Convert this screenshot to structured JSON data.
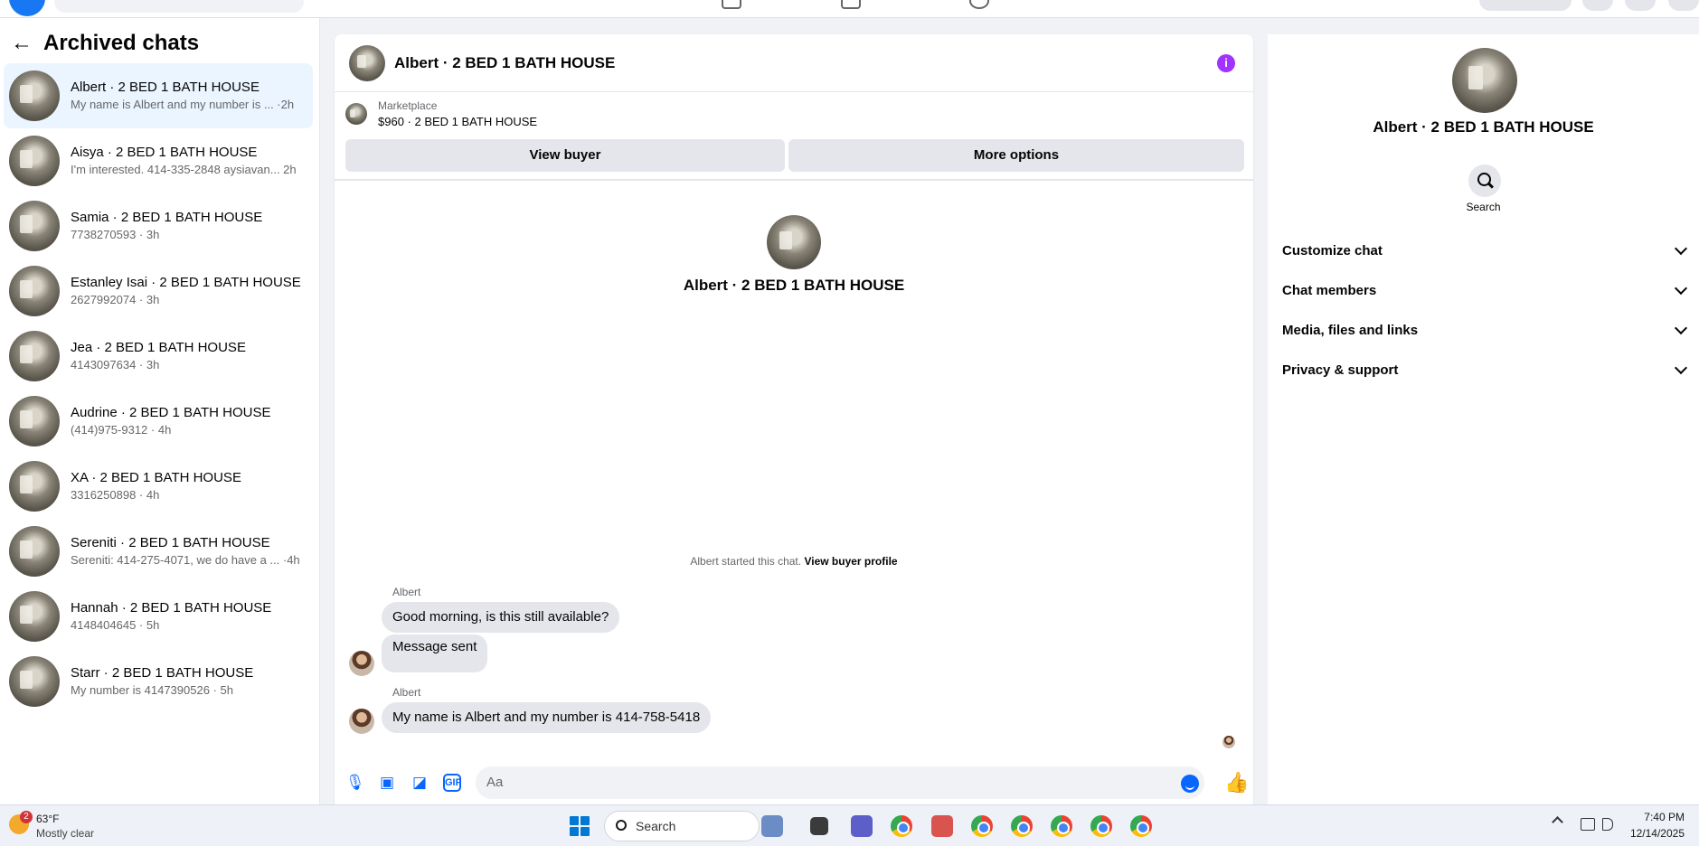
{
  "sidebar": {
    "title": "Archived chats",
    "chats": [
      {
        "name": "Albert · 2 BED 1 BATH HOUSE",
        "snippet": "My name is Albert and my number is ... ·2h"
      },
      {
        "name": "Aisya · 2 BED 1 BATH HOUSE",
        "snippet": "I'm interested. 414-335-2848 aysiavan... 2h"
      },
      {
        "name": "Samia · 2 BED 1 BATH HOUSE",
        "snippet": "7738270593 · 3h"
      },
      {
        "name": "Estanley Isai · 2 BED 1 BATH HOUSE",
        "snippet": "2627992074 · 3h"
      },
      {
        "name": "Jea · 2 BED 1 BATH HOUSE",
        "snippet": "4143097634 · 3h"
      },
      {
        "name": "Audrine · 2 BED 1 BATH HOUSE",
        "snippet": "(414)975-9312 · 4h"
      },
      {
        "name": "XA · 2 BED 1 BATH HOUSE",
        "snippet": "3316250898 · 4h"
      },
      {
        "name": "Sereniti · 2 BED 1 BATH HOUSE",
        "snippet": "Sereniti: 414-275-4071, we do have a ... ·4h"
      },
      {
        "name": "Hannah · 2 BED 1 BATH HOUSE",
        "snippet": "4148404645 · 5h"
      },
      {
        "name": "Starr · 2 BED 1 BATH HOUSE",
        "snippet": "My number is 4147390526 · 5h"
      }
    ]
  },
  "conversation": {
    "title": "Albert · 2 BED 1 BATH HOUSE",
    "marketplace_label": "Marketplace",
    "listing": "$960 · 2 BED 1 BATH HOUSE",
    "view_buyer": "View buyer",
    "more_options": "More options",
    "intro_name": "Albert · 2 BED 1 BATH HOUSE",
    "started_text": "Albert started this chat.",
    "view_buyer_profile": "View buyer profile",
    "messages": [
      {
        "sender": "Albert",
        "text": "Good morning, is this still available?"
      },
      {
        "text": "Message sent"
      },
      {
        "sender": "Albert",
        "text": "My name is Albert and my number is 414-758-5418"
      }
    ],
    "composer_placeholder": "Aa"
  },
  "details": {
    "name": "Albert · 2 BED 1 BATH HOUSE",
    "search_label": "Search",
    "sections": [
      "Customize chat",
      "Chat members",
      "Media, files and links",
      "Privacy & support"
    ]
  },
  "taskbar": {
    "weather_badge": "2",
    "temperature": "63°F",
    "condition": "Mostly clear",
    "search_label": "Search",
    "time": "7:40 PM",
    "date": "12/14/2025"
  },
  "colors": {
    "accent": "#0866ff",
    "info": "#a033ff",
    "active_chat": "#ebf5ff"
  }
}
